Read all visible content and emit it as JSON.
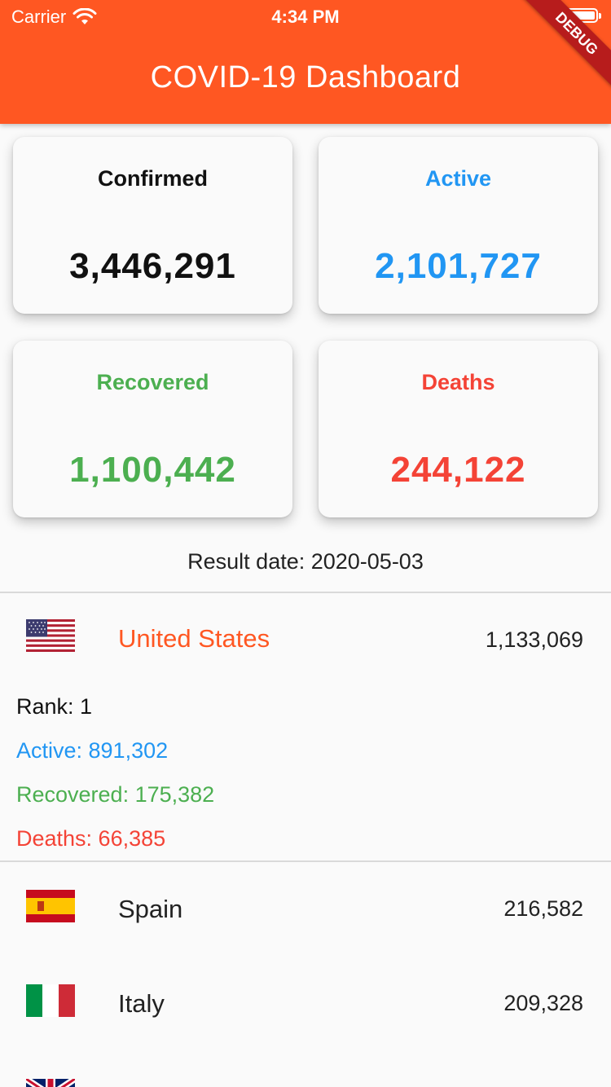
{
  "status_bar": {
    "carrier": "Carrier",
    "time": "4:34 PM",
    "wifi_icon": "wifi-icon",
    "battery_icon": "battery-icon"
  },
  "app_bar": {
    "title": "COVID-19 Dashboard",
    "debug_banner": "DEBUG"
  },
  "colors": {
    "accent": "#ff5722",
    "confirmed": "#111111",
    "active": "#2196f3",
    "recovered": "#4caf50",
    "deaths": "#f44336"
  },
  "cards": {
    "confirmed": {
      "label": "Confirmed",
      "value": "3,446,291"
    },
    "active": {
      "label": "Active",
      "value": "2,101,727"
    },
    "recovered": {
      "label": "Recovered",
      "value": "1,100,442"
    },
    "deaths": {
      "label": "Deaths",
      "value": "244,122"
    }
  },
  "result_date": "Result date: 2020-05-03",
  "countries": [
    {
      "name": "United States",
      "count": "1,133,069",
      "flag": "us-flag-icon",
      "expanded": true,
      "rank": "Rank: 1",
      "active": "Active: 891,302",
      "recovered": "Recovered: 175,382",
      "deaths": "Deaths: 66,385"
    },
    {
      "name": "Spain",
      "count": "216,582",
      "flag": "spain-flag-icon"
    },
    {
      "name": "Italy",
      "count": "209,328",
      "flag": "italy-flag-icon"
    },
    {
      "name": "",
      "count": "",
      "flag": "uk-flag-icon"
    }
  ]
}
